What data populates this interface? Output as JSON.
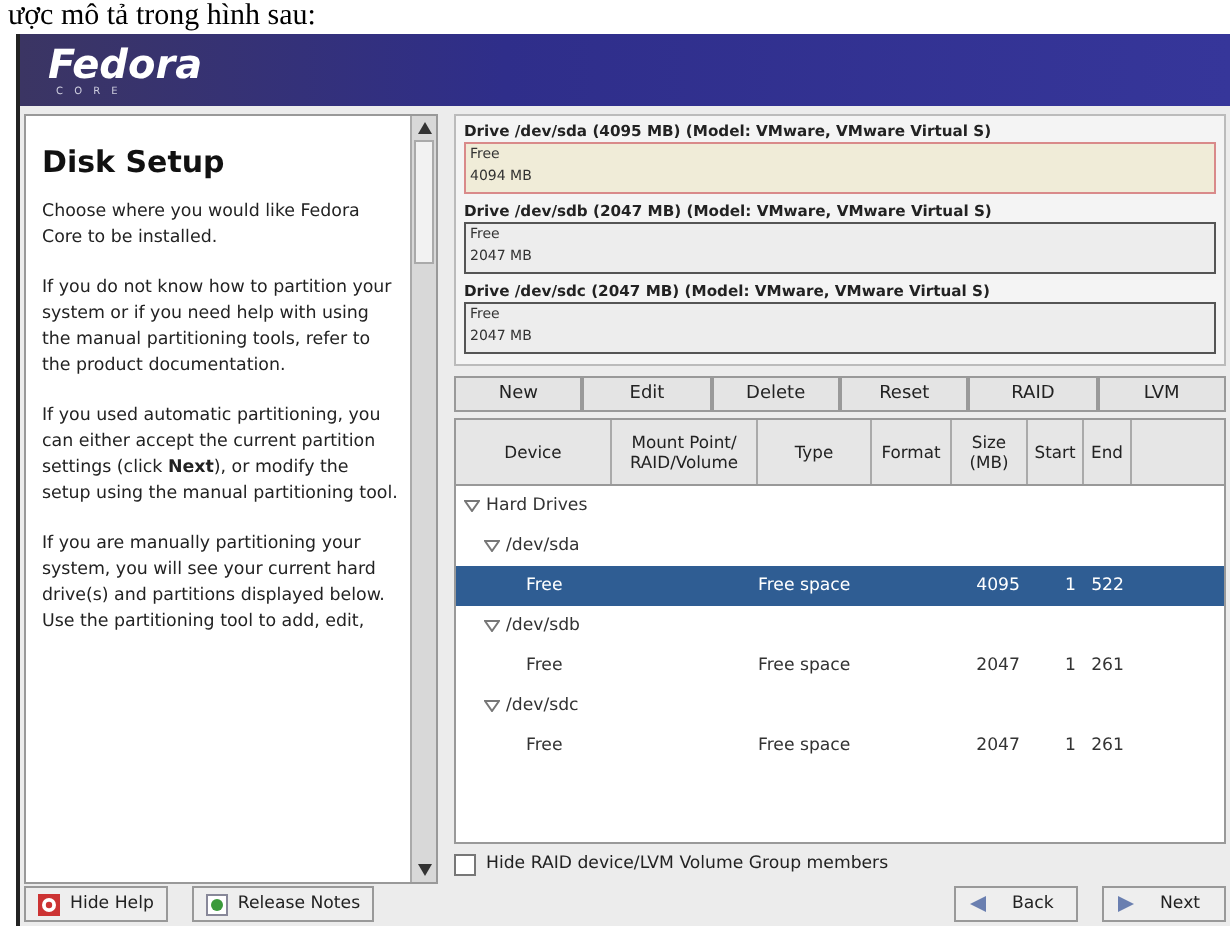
{
  "caption": "ược mô tả trong hình sau:",
  "banner": {
    "logo": "Fedora",
    "subtitle": "C O R E"
  },
  "help": {
    "title": "Disk Setup",
    "paragraphs": [
      "Choose where you would like Fedora Core to be installed.",
      "If you do not know how to partition your system or if you need help with using the manual partitioning tools, refer to the product documentation.",
      "If you used automatic partitioning, you can either accept the current partition settings (click **Next**), or modify the setup using the manual partitioning tool.",
      "If you are manually partitioning your system, you will see your current hard drive(s) and partitions displayed below. Use the partitioning tool to add, edit,"
    ]
  },
  "drives": [
    {
      "title": "Drive /dev/sda (4095 MB) (Model: VMware, VMware Virtual S)",
      "label": "Free",
      "size": "4094 MB",
      "selected": true
    },
    {
      "title": "Drive /dev/sdb (2047 MB) (Model: VMware, VMware Virtual S)",
      "label": "Free",
      "size": "2047 MB",
      "selected": false
    },
    {
      "title": "Drive /dev/sdc (2047 MB) (Model: VMware, VMware Virtual S)",
      "label": "Free",
      "size": "2047 MB",
      "selected": false
    }
  ],
  "toolbar": [
    "New",
    "Edit",
    "Delete",
    "Reset",
    "RAID",
    "LVM"
  ],
  "table": {
    "columns": [
      "Device",
      "Mount Point/ RAID/Volume",
      "Type",
      "Format",
      "Size (MB)",
      "Start",
      "End"
    ],
    "rows": [
      {
        "device": "Hard Drives",
        "expanded": true,
        "selected": false,
        "children": [
          {
            "device": "/dev/sda",
            "expanded": true,
            "selected": false,
            "children": [
              {
                "device": "Free",
                "type": "Free space",
                "size": "4095",
                "start": "1",
                "end": "522",
                "selected": true
              }
            ]
          },
          {
            "device": "/dev/sdb",
            "expanded": true,
            "selected": false,
            "children": [
              {
                "device": "Free",
                "type": "Free space",
                "size": "2047",
                "start": "1",
                "end": "261",
                "selected": false
              }
            ]
          },
          {
            "device": "/dev/sdc",
            "expanded": true,
            "selected": false,
            "children": [
              {
                "device": "Free",
                "type": "Free space",
                "size": "2047",
                "start": "1",
                "end": "261",
                "selected": false
              }
            ]
          }
        ]
      }
    ]
  },
  "hide_members": {
    "label": "Hide RAID device/LVM Volume Group members",
    "checked": false
  },
  "bottom_left": [
    "Hide Help",
    "Release Notes"
  ],
  "bottom_right": [
    "Back",
    "Next"
  ]
}
